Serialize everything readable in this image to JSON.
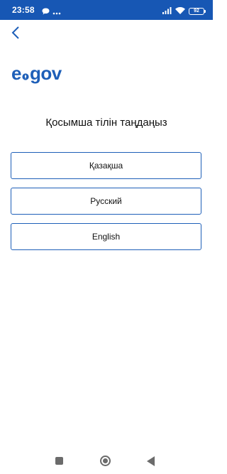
{
  "status_bar": {
    "time": "23:58",
    "battery": "92",
    "icons": [
      "chat-bubble-icon",
      "more-dots-icon",
      "signal-icon",
      "wifi-icon",
      "battery-icon"
    ]
  },
  "header": {
    "back_icon": "chevron-left-icon"
  },
  "logo": {
    "prefix": "e",
    "suffix": "gov"
  },
  "title": "Қосымша тілін таңдаңыз",
  "languages": [
    {
      "label": "Қазақша"
    },
    {
      "label": "Русский"
    },
    {
      "label": "English"
    }
  ],
  "nav_bar": {
    "icons": [
      "recents-square-icon",
      "home-circle-icon",
      "back-triangle-icon"
    ]
  },
  "colors": {
    "status_bar": "#1757b4",
    "brand_blue": "#1e5fb8",
    "nav_icon": "#6b6b6b"
  }
}
